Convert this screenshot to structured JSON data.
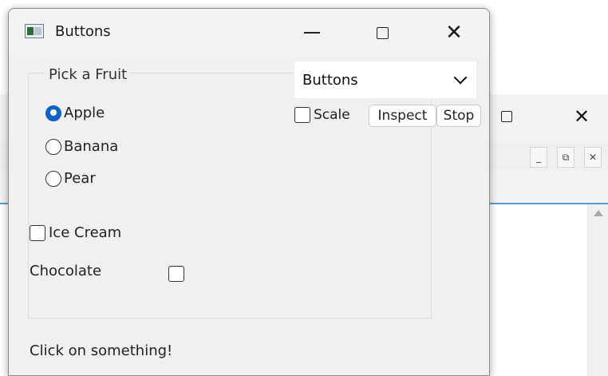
{
  "main_window": {
    "title": "Buttons",
    "icon": "app-window-icon",
    "controls": [
      "minimize-icon",
      "maximize-icon",
      "close-icon"
    ]
  },
  "fruit_group": {
    "legend": "Pick a Fruit",
    "options": [
      {
        "label": "Apple",
        "checked": true
      },
      {
        "label": "Banana",
        "checked": false
      },
      {
        "label": "Pear",
        "checked": false
      }
    ]
  },
  "ice_cream": {
    "label": "Ice Cream",
    "checked": false
  },
  "chocolate": {
    "label": "Chocolate",
    "checked": false
  },
  "status_text": "Click on something!",
  "toolbar": {
    "dropdown_value": "Buttons",
    "scale_label": "Scale",
    "scale_checked": false,
    "inspect_label": "Inspect",
    "stop_label": "Stop"
  },
  "background_window": {
    "controls": [
      "maximize-icon",
      "close-icon"
    ],
    "mini_buttons": [
      "_",
      "⧉",
      "✕"
    ]
  },
  "colors": {
    "accent": "#1061c8",
    "window_bg": "#f0f0f0"
  }
}
